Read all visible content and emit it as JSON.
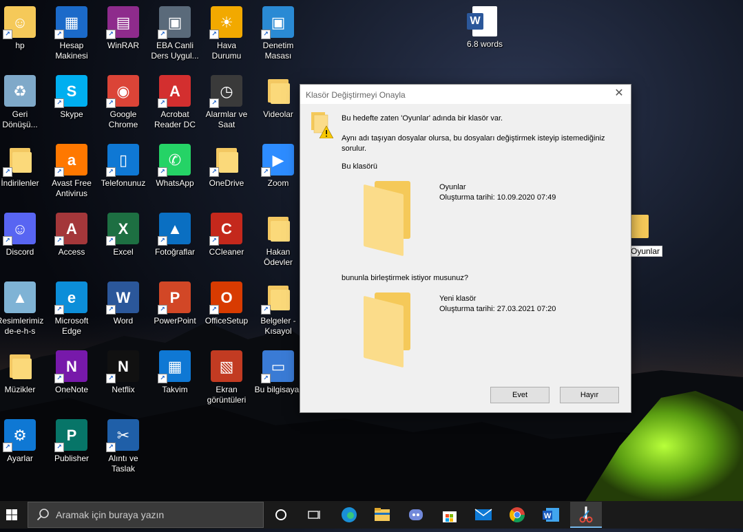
{
  "desktop": {
    "icons": [
      {
        "label": "hp",
        "icon": "user-folder-icon"
      },
      {
        "label": "Hesap Makinesi",
        "icon": "calculator-icon"
      },
      {
        "label": "WinRAR",
        "icon": "winrar-icon"
      },
      {
        "label": "EBA Canli Ders Uygul...",
        "icon": "eba-icon"
      },
      {
        "label": "Hava Durumu",
        "icon": "weather-icon"
      },
      {
        "label": "Denetim Masası",
        "icon": "control-panel-icon"
      },
      {
        "label": "Geri Dönüşü...",
        "icon": "recycle-bin-icon"
      },
      {
        "label": "Skype",
        "icon": "skype-icon"
      },
      {
        "label": "Google Chrome",
        "icon": "chrome-icon"
      },
      {
        "label": "Acrobat Reader DC",
        "icon": "acrobat-icon"
      },
      {
        "label": "Alarmlar ve Saat",
        "icon": "alarm-clock-icon"
      },
      {
        "label": "Videolar",
        "icon": "videos-folder-icon"
      },
      {
        "label": "İndirilenler",
        "icon": "downloads-folder-icon"
      },
      {
        "label": "Avast Free Antivirus",
        "icon": "avast-icon"
      },
      {
        "label": "Telefonunuz",
        "icon": "phone-icon"
      },
      {
        "label": "WhatsApp",
        "icon": "whatsapp-icon"
      },
      {
        "label": "OneDrive",
        "icon": "onedrive-icon"
      },
      {
        "label": "Zoom",
        "icon": "zoom-icon"
      },
      {
        "label": "Discord",
        "icon": "discord-icon"
      },
      {
        "label": "Access",
        "icon": "access-icon"
      },
      {
        "label": "Excel",
        "icon": "excel-icon"
      },
      {
        "label": "Fotoğraflar",
        "icon": "photos-icon"
      },
      {
        "label": "CCleaner",
        "icon": "ccleaner-icon"
      },
      {
        "label": "Hakan Ödevler",
        "icon": "folder-icon"
      },
      {
        "label": "Resimlerimiz de-e-h-s",
        "icon": "pictures-icon"
      },
      {
        "label": "Microsoft Edge",
        "icon": "edge-icon"
      },
      {
        "label": "Word",
        "icon": "word-icon"
      },
      {
        "label": "PowerPoint",
        "icon": "powerpoint-icon"
      },
      {
        "label": "OfficeSetup",
        "icon": "office-icon"
      },
      {
        "label": "Belgeler - Kısayol",
        "icon": "documents-folder-icon"
      },
      {
        "label": "Müzikler",
        "icon": "music-folder-icon"
      },
      {
        "label": "OneNote",
        "icon": "onenote-icon"
      },
      {
        "label": "Netflix",
        "icon": "netflix-icon"
      },
      {
        "label": "Takvim",
        "icon": "calendar-icon"
      },
      {
        "label": "Ekran görüntüleri",
        "icon": "screenshots-icon"
      },
      {
        "label": "Bu bilgisayar",
        "icon": "computer-icon"
      },
      {
        "label": "Ayarlar",
        "icon": "settings-icon"
      },
      {
        "label": "Publisher",
        "icon": "publisher-icon"
      },
      {
        "label": "Alıntı ve Taslak",
        "icon": "snip-sketch-icon"
      }
    ],
    "word_doc_label": "6.8 words",
    "oyunlar_label": "Oyunlar"
  },
  "dialog": {
    "title": "Klasör Değiştirmeyi Onayla",
    "message": "Bu hedefte zaten 'Oyunlar' adında bir klasör var.",
    "detail": "Aynı adı taşıyan dosyalar olursa, bu dosyaları değiştirmek isteyip istemediğiniz sorulur.",
    "this_folder_label": "Bu klasörü",
    "existing": {
      "name": "Oyunlar",
      "date": "Oluşturma tarihi: 10.09.2020 07:49"
    },
    "merge_question": "bununla birleştirmek istiyor musunuz?",
    "new": {
      "name": "Yeni klasör",
      "date": "Oluşturma tarihi: 27.03.2021 07:20"
    },
    "yes_button": "Evet",
    "no_button": "Hayır"
  },
  "taskbar": {
    "search_placeholder": "Aramak için buraya yazın",
    "apps": [
      "cortana-icon",
      "task-view-icon",
      "edge-icon",
      "file-explorer-icon",
      "discord-icon",
      "store-icon",
      "mail-icon",
      "chrome-icon",
      "word-icon",
      "snip-sketch-icon"
    ]
  },
  "colors": {
    "accent": "#0078d7",
    "folder": "#f5c959",
    "taskbar": "#1a1a1a"
  }
}
